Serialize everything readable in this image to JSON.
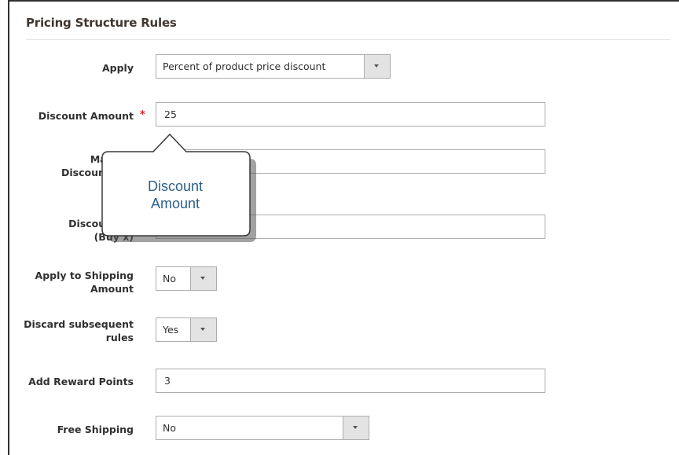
{
  "section": {
    "title": "Pricing Structure Rules"
  },
  "fields": {
    "apply": {
      "label": "Apply",
      "value": "Percent of product price discount"
    },
    "discount_amount": {
      "label": "Discount Amount",
      "required_mark": "*",
      "value": "25"
    },
    "max_qty": {
      "label_line1": "Maximu",
      "label_line2": "Discount is A",
      "value": ""
    },
    "discount_step": {
      "label_line1": "Discount Qt",
      "label_line2": "(Buy x)",
      "value": ""
    },
    "apply_shipping": {
      "label_line1": "Apply to Shipping",
      "label_line2": "Amount",
      "value": "No"
    },
    "discard_rules": {
      "label_line1": "Discard subsequent",
      "label_line2": "rules",
      "value": "Yes"
    },
    "reward_points": {
      "label": "Add Reward Points",
      "value": "3"
    },
    "free_shipping": {
      "label": "Free Shipping",
      "value": "No"
    }
  },
  "callout": {
    "line1": "Discount",
    "line2": "Amount"
  },
  "icons": {
    "dropdown": "chevron-down-icon"
  }
}
